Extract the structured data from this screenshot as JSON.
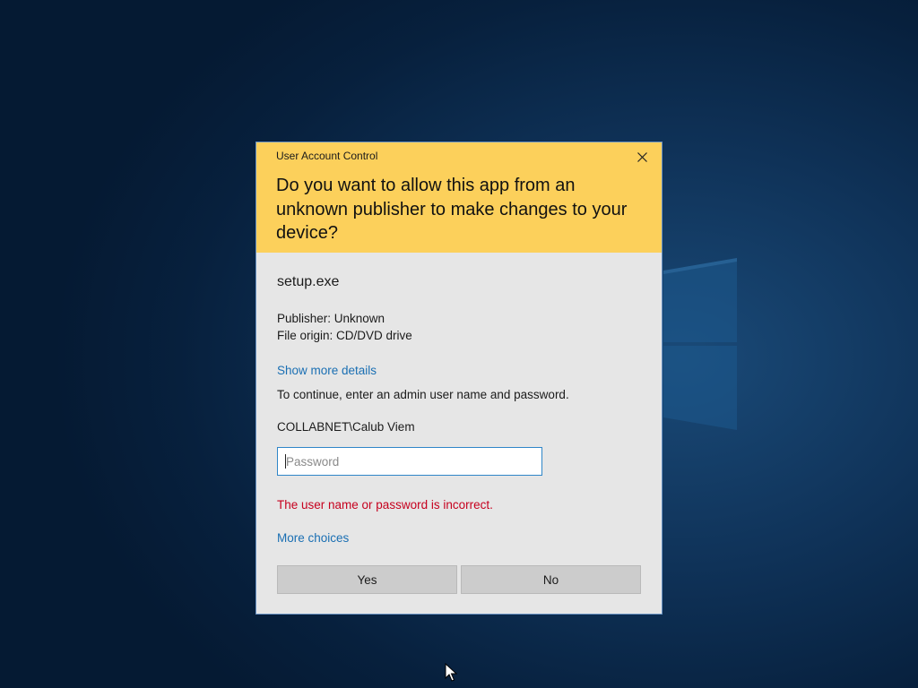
{
  "dialog": {
    "title": "User Account Control",
    "question": "Do you want to allow this app from an unknown publisher to make changes to your device?",
    "app_name": "setup.exe",
    "publisher": "Publisher: Unknown",
    "file_origin": "File origin: CD/DVD drive",
    "show_more_details": "Show more details",
    "instructions": "To continue, enter an admin user name and password.",
    "username": "COLLABNET\\Calub Viem",
    "password": {
      "placeholder": "Password",
      "value": ""
    },
    "error_message": "The user name or password is incorrect.",
    "more_choices": "More choices",
    "yes_label": "Yes",
    "no_label": "No",
    "icons": {
      "close": "close-icon",
      "logo": "windows-logo-icon",
      "cursor": "mouse-pointer-icon"
    },
    "colors": {
      "header": "#fcd05b",
      "body": "#e6e6e6",
      "link": "#1a6fb3",
      "error": "#c6001e",
      "desktop": "#0f3258"
    }
  }
}
